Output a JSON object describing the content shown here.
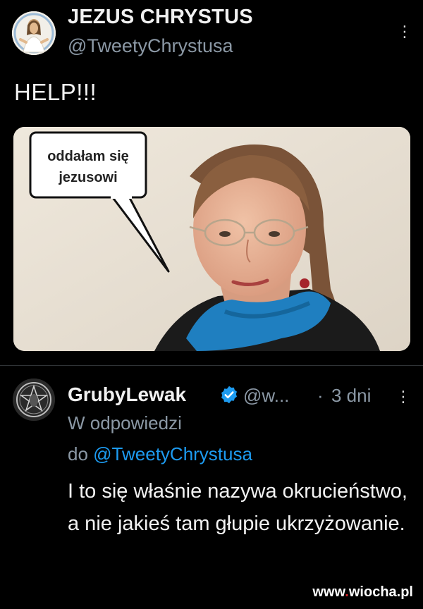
{
  "tweet": {
    "author_name": "JEZUS CHRYSTUS",
    "author_handle": "@TweetyChrystusa",
    "text": "HELP!!!",
    "more_icon": "more-vertical-icon",
    "media": {
      "speech_bubble_line1": "oddałam się",
      "speech_bubble_line2": "jezusowi"
    }
  },
  "reply": {
    "author_name": "GrubyLewak",
    "verified_icon": "verified-badge-icon",
    "author_handle": "@w...",
    "separator": "·",
    "time": "3 dni",
    "more_icon": "more-vertical-icon",
    "context_line1": "W odpowiedzi",
    "context_prefix": "do",
    "context_mention": "@TweetyChrystusa",
    "text": "I to się właśnie nazywa okrucieństwo, a nie jakieś tam głupie ukrzyżowanie."
  },
  "watermark": {
    "prefix": "www",
    "dot": ".",
    "name": "wiocha",
    "suffix": ".pl"
  },
  "colors": {
    "background": "#000000",
    "text": "#e7e9ea",
    "secondary": "#8b98a5",
    "link": "#1d9bf0",
    "divider": "#2f3336"
  }
}
